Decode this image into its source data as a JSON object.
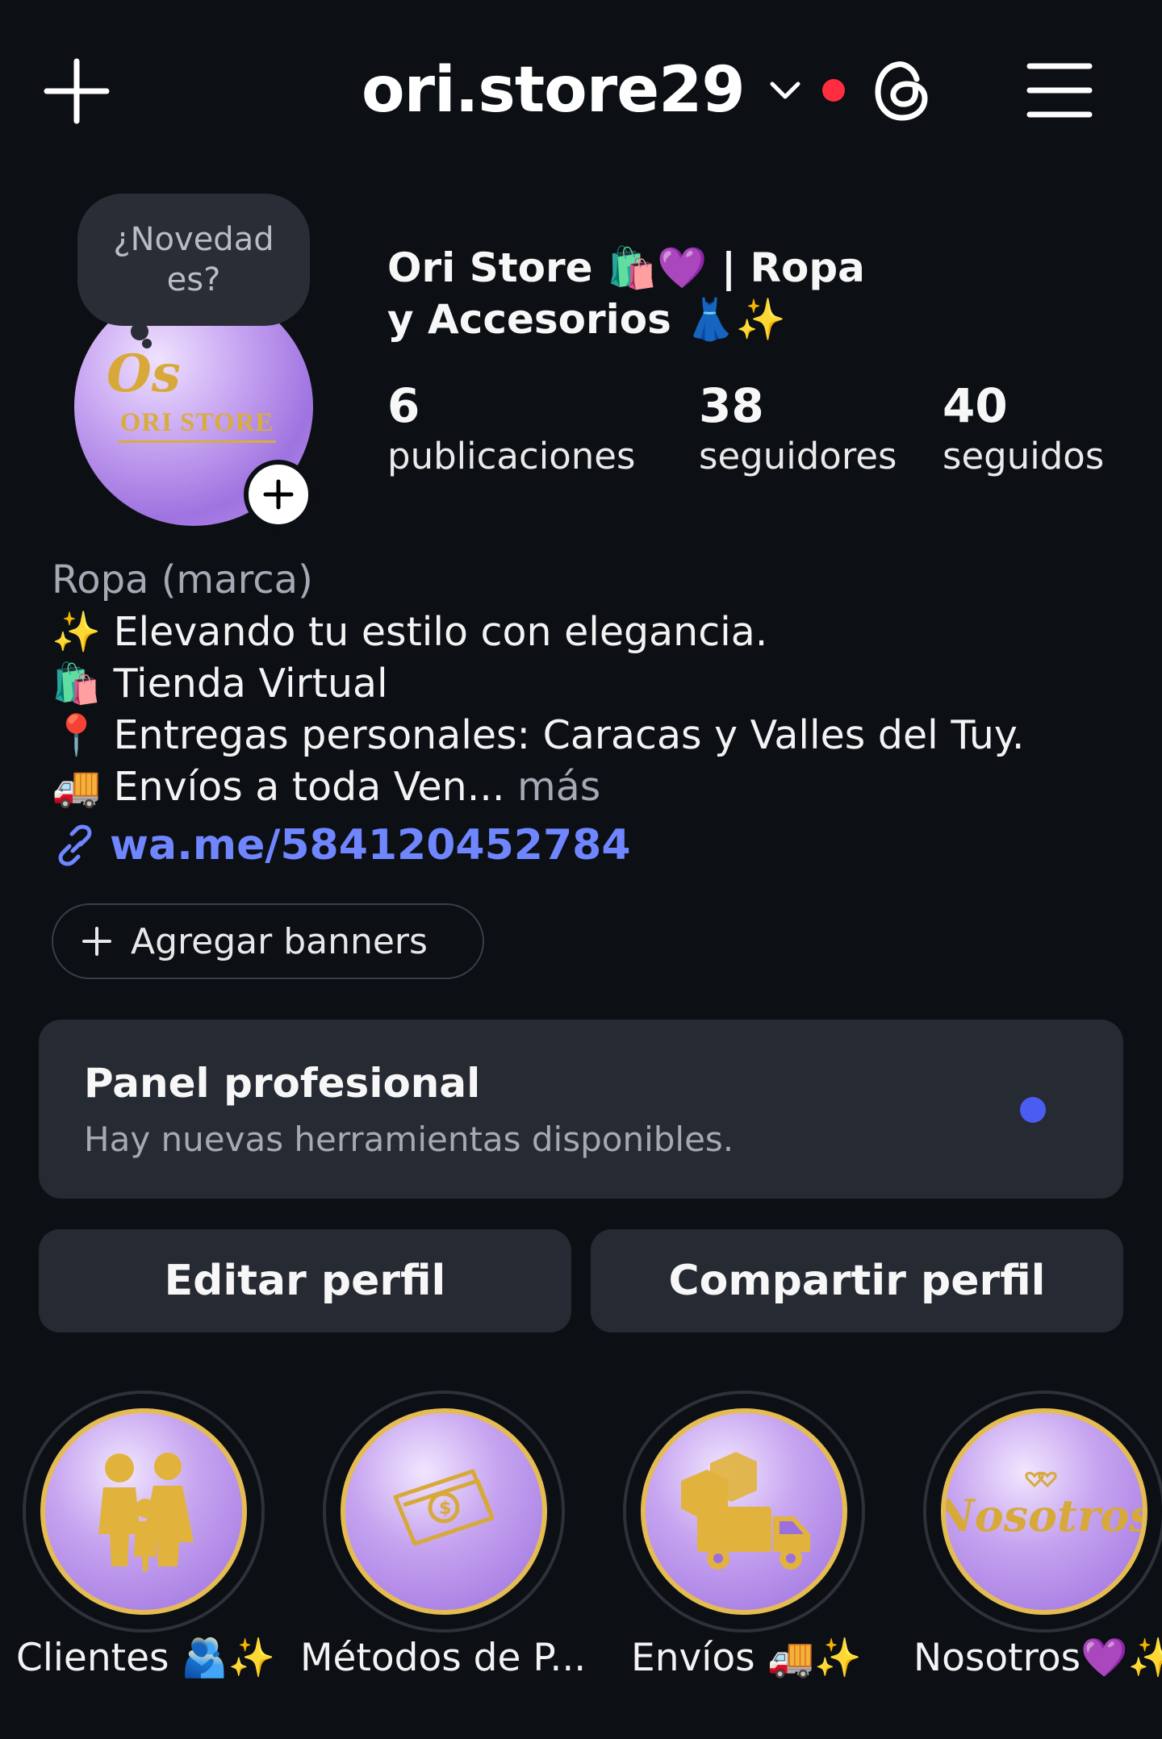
{
  "header": {
    "username": "ori.store29",
    "icons": [
      "plus-icon",
      "chevron-down-icon",
      "threads-icon",
      "menu-icon"
    ],
    "notification_dot_color": "#ff2d3f"
  },
  "profile": {
    "note_text": "¿Novedad es?",
    "avatar_logo_monogram": "Os",
    "avatar_logo_text": "ORI STORE",
    "display_name": "Ori Store 🛍️💜 | Ropa y Accesorios 👗✨",
    "stats": [
      {
        "value": "6",
        "label": "publicaciones"
      },
      {
        "value": "38",
        "label": "seguidores"
      },
      {
        "value": "40",
        "label": "seguidos"
      }
    ]
  },
  "bio": {
    "category": "Ropa (marca)",
    "lines": [
      "✨ Elevando tu estilo con elegancia.",
      "🛍️ Tienda Virtual",
      "📍 Entregas personales: Caracas y Valles del Tuy.",
      "🚚 Envíos a toda Ven..."
    ],
    "more": "más",
    "link": "wa.me/584120452784",
    "link_color": "#6f86ff"
  },
  "banner_button": {
    "label": "Agregar banners"
  },
  "pro_panel": {
    "title": "Panel profesional",
    "subtitle": "Hay nuevas herramientas disponibles.",
    "dot_color": "#4b5cf2"
  },
  "buttons": {
    "edit": "Editar perfil",
    "share": "Compartir perfil"
  },
  "highlights": [
    {
      "label": "Clientes 🫂✨",
      "icon": "family-icon"
    },
    {
      "label": "Métodos de P...",
      "icon": "money-icon"
    },
    {
      "label": "Envíos 🚚✨",
      "icon": "truck-icon"
    },
    {
      "label": "Nosotros💜✨",
      "icon": "nosotros-script-icon",
      "cover_text": "Nosotros"
    }
  ]
}
